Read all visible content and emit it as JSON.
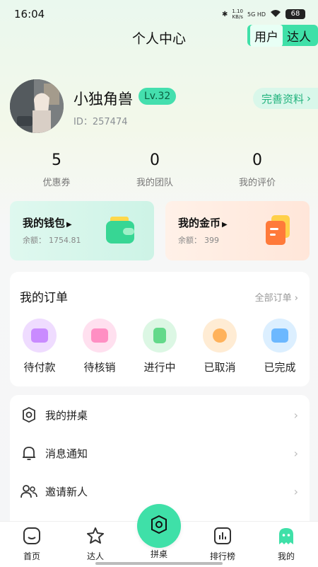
{
  "status": {
    "time": "16:04",
    "speed_value": "1.10",
    "speed_unit": "KB/s",
    "network": "5G HD",
    "battery": "68"
  },
  "header": {
    "title": "个人中心",
    "role_options": [
      "用户",
      "达人"
    ],
    "active_role": "用户"
  },
  "profile": {
    "name": "小独角兽",
    "level": "Lv.32",
    "id_label": "ID：",
    "id_value": "257474",
    "complete_label": "完善资料",
    "complete_arrow": "›"
  },
  "stats": [
    {
      "value": "5",
      "label": "优惠券"
    },
    {
      "value": "0",
      "label": "我的团队"
    },
    {
      "value": "0",
      "label": "我的评价"
    }
  ],
  "wallet": {
    "title": "我的钱包",
    "balance_label": "余额：",
    "balance": "1754.81"
  },
  "coins": {
    "title": "我的金币",
    "balance_label": "余额：",
    "balance": "399"
  },
  "orders": {
    "title": "我的订单",
    "all_label": "全部订单",
    "items": [
      {
        "label": "待付款",
        "icon": "wallet-icon",
        "color": "#c98bff"
      },
      {
        "label": "待核销",
        "icon": "calendar-icon",
        "color": "#ff8fc3"
      },
      {
        "label": "进行中",
        "icon": "document-icon",
        "color": "#63d98a"
      },
      {
        "label": "已取消",
        "icon": "cancel-icon",
        "color": "#ffb25b"
      },
      {
        "label": "已完成",
        "icon": "check-icon",
        "color": "#6cb8ff"
      }
    ]
  },
  "menu": [
    {
      "label": "我的拼桌",
      "icon": "table-icon"
    },
    {
      "label": "消息通知",
      "icon": "bell-icon"
    },
    {
      "label": "邀请新人",
      "icon": "users-icon"
    }
  ],
  "nav": [
    {
      "label": "首页",
      "icon": "home-icon"
    },
    {
      "label": "达人",
      "icon": "star-icon"
    },
    {
      "label": "拼桌",
      "icon": "table-icon"
    },
    {
      "label": "排行榜",
      "icon": "chart-icon"
    },
    {
      "label": "我的",
      "icon": "ghost-icon"
    }
  ],
  "colors": {
    "accent": "#3fe0a8",
    "accent_text": "#20b27c"
  }
}
